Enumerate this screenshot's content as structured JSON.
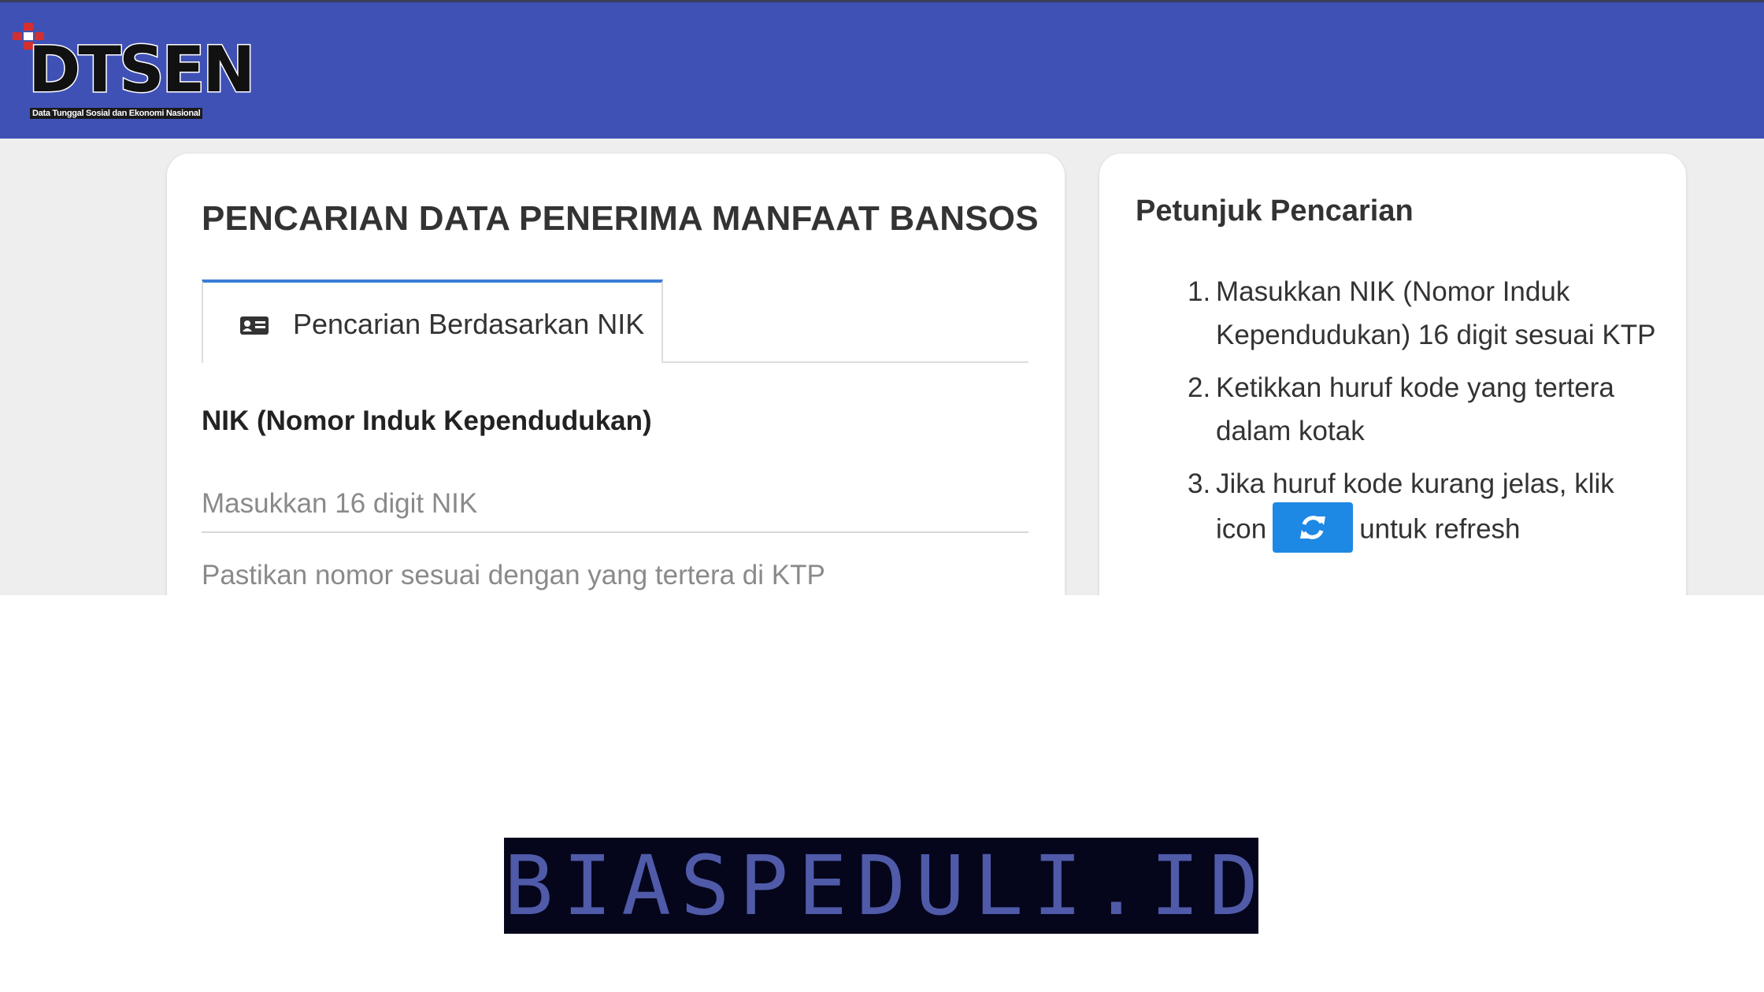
{
  "header": {
    "logo_text": "DTSEN",
    "logo_tagline": "Data Tunggal Sosial dan Ekonomi Nasional",
    "colors": {
      "bar": "#3f51b5",
      "logo_mark": "#d32f2f"
    }
  },
  "search": {
    "title": "PENCARIAN DATA PENERIMA MANFAAT BANSOS",
    "tab_label": "Pencarian Berdasarkan NIK",
    "tab_icon": "id-card-icon",
    "field_label": "NIK (Nomor Induk Kependudukan)",
    "placeholder": "Masukkan 16 digit NIK",
    "help_text": "Pastikan nomor sesuai dengan yang tertera di KTP",
    "accent": "#3a7dd8"
  },
  "guide": {
    "title": "Petunjuk Pencarian",
    "steps": [
      {
        "num": "1.",
        "text": "Masukkan NIK (Nomor Induk Kependudukan) 16 digit sesuai KTP"
      },
      {
        "num": "2.",
        "text": "Ketikkan huruf kode yang tertera dalam kotak"
      },
      {
        "num": "3.",
        "before": "Jika huruf kode kurang jelas, klik icon",
        "after": "untuk refresh"
      }
    ],
    "refresh_icon": "refresh-icon",
    "button_color": "#1e88e5"
  },
  "watermark": {
    "text": "BIASPEDULI.ID"
  }
}
